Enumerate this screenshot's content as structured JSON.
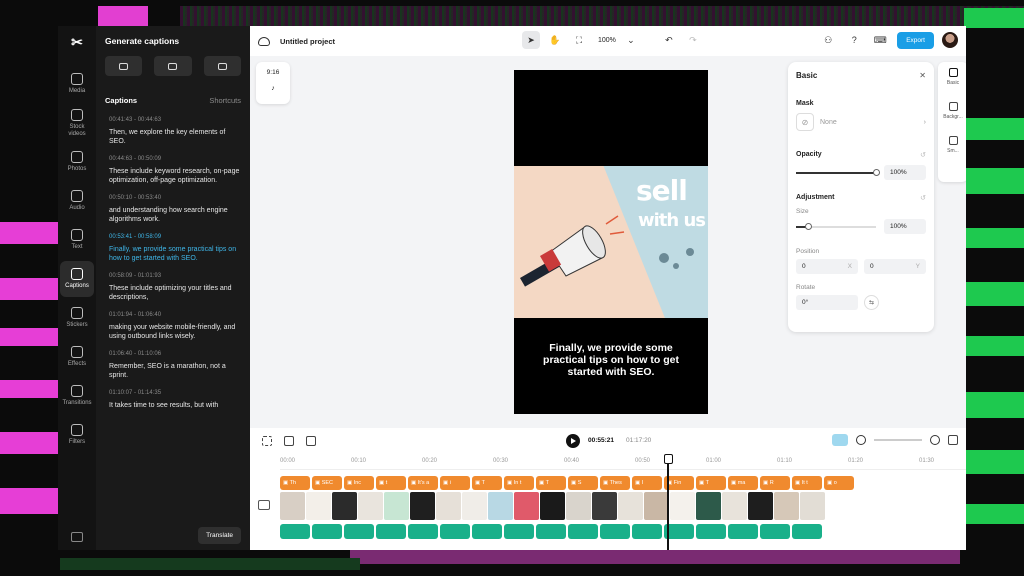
{
  "project": {
    "title": "Untitled project",
    "zoom": "100%",
    "export_label": "Export"
  },
  "rail": {
    "items": [
      {
        "label": "Media"
      },
      {
        "label": "Stock videos"
      },
      {
        "label": "Photos"
      },
      {
        "label": "Audio"
      },
      {
        "label": "Text"
      },
      {
        "label": "Captions",
        "active": true
      },
      {
        "label": "Stickers"
      },
      {
        "label": "Effects"
      },
      {
        "label": "Transitions"
      },
      {
        "label": "Filters"
      }
    ]
  },
  "captions_panel": {
    "title": "Generate captions",
    "section_label": "Captions",
    "shortcuts_label": "Shortcuts",
    "translate_label": "Translate",
    "items": [
      {
        "time": "00:41:43 - 00:44:63",
        "text": "Then, we explore the key elements of SEO."
      },
      {
        "time": "00:44:63 - 00:50:09",
        "text": "These include keyword research, on-page optimization, off-page optimization."
      },
      {
        "time": "00:50:10 - 00:53:40",
        "text": "and understanding how search engine algorithms work."
      },
      {
        "time": "00:53:41 - 00:58:09",
        "text": "Finally, we provide some practical tips on how to get started with SEO.",
        "active": true
      },
      {
        "time": "00:58:09 - 01:01:93",
        "text": "These include optimizing your titles and descriptions,"
      },
      {
        "time": "01:01:94 - 01:06:40",
        "text": "making your website mobile-friendly, and using outbound links wisely."
      },
      {
        "time": "01:06:40 - 01:10:06",
        "text": "Remember, SEO is a marathon, not a sprint."
      },
      {
        "time": "01:10:07 - 01:14:35",
        "text": "It takes time to see results, but with"
      }
    ]
  },
  "canvas": {
    "ratio": "9:16",
    "platform": "tiktok-icon",
    "art_title": "sell",
    "art_subtitle": "with us",
    "subtitle": "Finally, we provide some practical tips on how to get started with SEO."
  },
  "basic_panel": {
    "title": "Basic",
    "mask_label": "Mask",
    "mask_value": "None",
    "opacity_label": "Opacity",
    "opacity_value": "100%",
    "opacity_fraction": 1.0,
    "adjustment_label": "Adjustment",
    "size_label": "Size",
    "size_value": "100%",
    "size_fraction": 0.15,
    "position_label": "Position",
    "pos_x": "0",
    "pos_x_axis": "X",
    "pos_y": "0",
    "pos_y_axis": "Y",
    "rotate_label": "Rotate",
    "rotate_value": "0°"
  },
  "mini_rail": {
    "items": [
      {
        "label": "Basic",
        "active": true
      },
      {
        "label": "Backgr..."
      },
      {
        "label": "Sm..."
      }
    ]
  },
  "timeline": {
    "current": "00:55:21",
    "total": "01:17:20",
    "ticks": [
      "00:00",
      "00:10",
      "00:20",
      "00:30",
      "00:40",
      "00:50",
      "01:00",
      "01:10",
      "01:20",
      "01:30"
    ],
    "caption_clips": [
      "Th",
      "SEC",
      "Inc",
      "t",
      "It's a",
      "i",
      "T",
      "In t",
      "T",
      "S",
      "Thes",
      "I",
      "Fin",
      "T",
      "ma",
      "R",
      "It t",
      "o"
    ]
  },
  "colors": {
    "accent": "#1a9ee6",
    "caption_clip": "#f08a2e",
    "audio_clip": "#19b08a",
    "active_caption": "#3fb6e8"
  }
}
